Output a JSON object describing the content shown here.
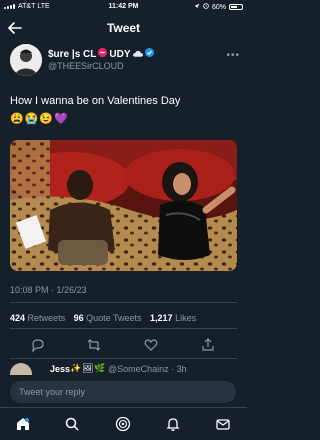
{
  "status_bar": {
    "carrier": "AT&T",
    "network": "LTE",
    "time": "11:42 PM",
    "battery": "60%",
    "battery_level": 0.6
  },
  "header": {
    "title": "Tweet"
  },
  "tweet": {
    "display_name": "$ure |s CL",
    "display_name_tail": "UDY",
    "handle": "@THEESirCLOUD",
    "text": "How I wanna be on Valentines Day",
    "emojis": [
      "😩",
      "😭",
      "😉",
      "💜"
    ],
    "timestamp": "10:08 PM · 1/26/23",
    "stats": {
      "retweets": "424",
      "retweets_label": "Retweets",
      "quotes": "96",
      "quotes_label": "Quote Tweets",
      "likes": "1,217",
      "likes_label": "Likes"
    }
  },
  "reply_preview": {
    "name": "Jess",
    "meta": "@SomeChainz · 3h"
  },
  "reply_box": {
    "placeholder": "Tweet your reply"
  },
  "icons": {
    "header": [
      "back-arrow-icon"
    ],
    "author": [
      "verified-badge-icon",
      "cloud-icon",
      "more-icon"
    ],
    "actions": [
      "reply-icon",
      "retweet-icon",
      "like-icon",
      "share-icon"
    ],
    "tabs": [
      "home-icon",
      "search-icon",
      "spaces-icon",
      "notifications-icon",
      "messages-icon"
    ]
  },
  "colors": {
    "background": "#15202b",
    "text_secondary": "#8b98a5",
    "accent": "#1d9bf0",
    "divider": "#38444d"
  }
}
